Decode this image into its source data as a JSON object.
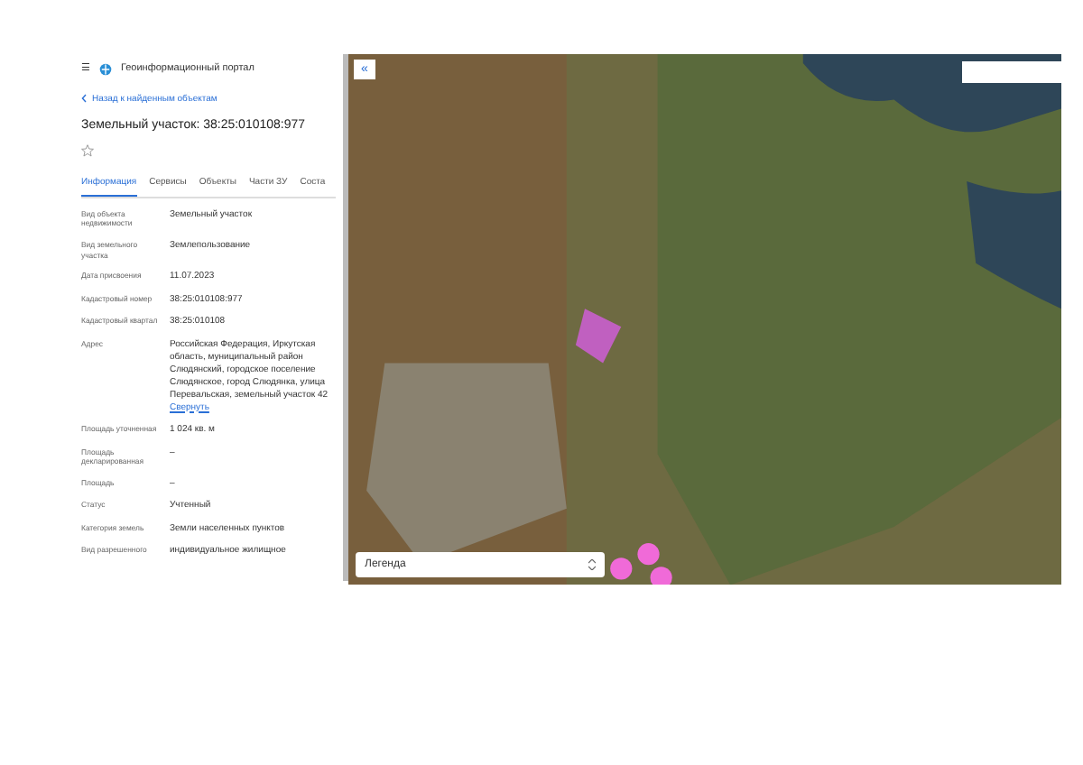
{
  "header": {
    "menu_icon": "☰",
    "title": "Геоинформационный портал"
  },
  "back_link": "Назад к найденным объектам",
  "object_title": "Земельный участок: 38:25:010108:977",
  "favorite": {
    "on": false
  },
  "tabs": [
    {
      "label": "Информация",
      "selected": true
    },
    {
      "label": "Сервисы",
      "selected": false
    },
    {
      "label": "Объекты",
      "selected": false
    },
    {
      "label": "Части ЗУ",
      "selected": false
    },
    {
      "label": "Соста",
      "selected": false
    }
  ],
  "fields": [
    {
      "label": "Вид объекта недвижимости",
      "value": "Земельный участок"
    },
    {
      "label": "Вид земельного участка",
      "value": "Землепользование"
    },
    {
      "label": "Дата присвоения",
      "value": "11.07.2023"
    },
    {
      "label": "Кадастровый номер",
      "value": "38:25:010108:977"
    },
    {
      "label": "Кадастровый квартал",
      "value": "38:25:010108"
    },
    {
      "label": "Адрес",
      "value": "Российская Федерация, Иркутская область, муниципальный район Слюдянский, городское поселение Слюдянское, город Слюдянка, улица Перевальская, земельный участок 42",
      "link": "Свернуть"
    },
    {
      "label": "Площадь уточненная",
      "value": "1 024 кв. м"
    },
    {
      "label": "Площадь декларированная",
      "value": "–"
    },
    {
      "label": "Площадь",
      "value": "–"
    },
    {
      "label": "Статус",
      "value": "Учтенный"
    },
    {
      "label": "Категория земель",
      "value": "Земли населенных пунктов"
    },
    {
      "label": "Вид разрешенного",
      "value": "индивидуальное жилищное"
    }
  ],
  "map": {
    "collapse_button": "«",
    "legend": {
      "label": "Легенда"
    }
  }
}
